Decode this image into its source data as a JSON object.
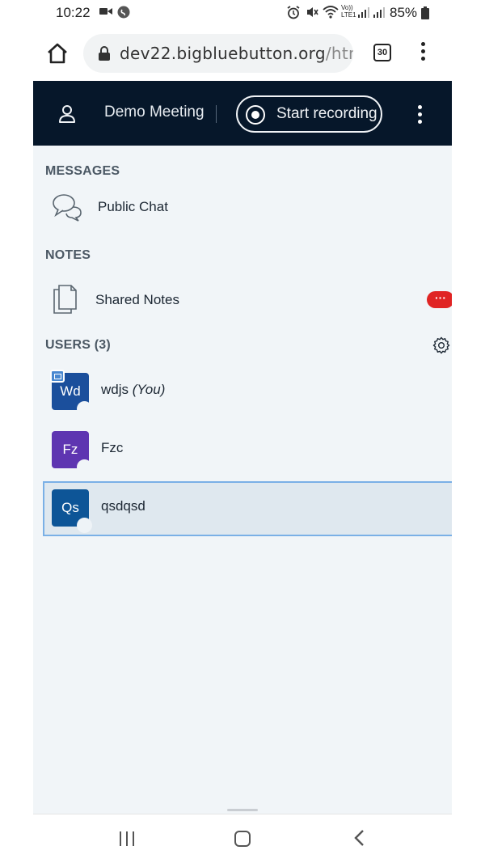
{
  "status_bar": {
    "time": "10:22",
    "battery": "85%",
    "volte": "Vo)) LTE1"
  },
  "browser": {
    "url_main": "dev22.bigbluebutton.org",
    "url_rest": "/htm",
    "tab_count": "30"
  },
  "header": {
    "meeting_title": "Demo Meeting",
    "record_label": "Start recording"
  },
  "messages": {
    "title": "MESSAGES",
    "items": [
      {
        "label": "Public Chat",
        "icon": "chat-icon"
      }
    ]
  },
  "notes": {
    "title": "NOTES",
    "items": [
      {
        "label": "Shared Notes",
        "icon": "notes-icon",
        "badge": "···"
      }
    ]
  },
  "users": {
    "title": "USERS (3)",
    "list": [
      {
        "initials": "Wd",
        "name": "wdjs",
        "suffix": "(You)",
        "color": "#1b4f9c",
        "presenter": true,
        "selected": false
      },
      {
        "initials": "Fz",
        "name": "Fzc",
        "suffix": "",
        "color": "#5e35b1",
        "presenter": false,
        "selected": false
      },
      {
        "initials": "Qs",
        "name": "qsdqsd",
        "suffix": "",
        "color": "#0d5597",
        "presenter": false,
        "selected": true
      }
    ]
  },
  "colors": {
    "header_bg": "#06172a",
    "panel_bg": "#f1f5f8",
    "badge_red": "#e02424",
    "selection_border": "#7ab0e6"
  }
}
